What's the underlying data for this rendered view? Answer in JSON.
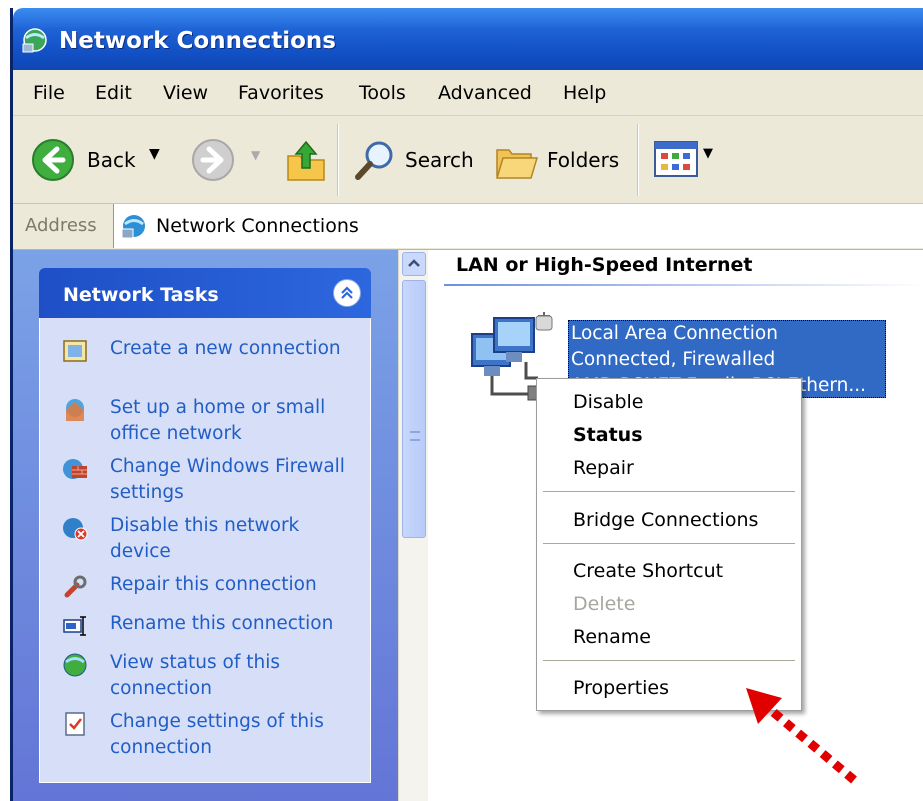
{
  "window": {
    "title": "Network Connections"
  },
  "menu": [
    "File",
    "Edit",
    "View",
    "Favorites",
    "Tools",
    "Advanced",
    "Help"
  ],
  "toolbar": {
    "back": "Back",
    "search": "Search",
    "folders": "Folders"
  },
  "address": {
    "label": "Address",
    "value": "Network Connections"
  },
  "tasks": {
    "header": "Network Tasks",
    "items": [
      {
        "label": "Create a new connection",
        "icon": "new-connection-icon"
      },
      {
        "label": "Set up a home or small office network",
        "icon": "home-network-icon"
      },
      {
        "label": "Change Windows Firewall settings",
        "icon": "firewall-icon"
      },
      {
        "label": "Disable this network device",
        "icon": "disable-network-icon"
      },
      {
        "label": "Repair this connection",
        "icon": "repair-icon"
      },
      {
        "label": "Rename this connection",
        "icon": "rename-icon"
      },
      {
        "label": "View status of this connection",
        "icon": "status-icon"
      },
      {
        "label": "Change settings of this connection",
        "icon": "settings-icon"
      }
    ]
  },
  "content": {
    "group_header": "LAN or High-Speed Internet",
    "connection": {
      "name": "Local Area Connection",
      "status": "Connected, Firewalled",
      "device": "AMD PCNET Family PCI Ethern..."
    }
  },
  "context_menu": {
    "items": [
      "Disable",
      "Status",
      "Repair",
      "Bridge Connections",
      "Create Shortcut",
      "Delete",
      "Rename",
      "Properties"
    ],
    "default_item": "Status",
    "disabled_item": "Delete"
  },
  "colors": {
    "titlebar": "#1f63d6",
    "left_pane": "#6f8be0",
    "task_link": "#215dc6",
    "selection": "#316ac5",
    "arrow": "#e00000"
  }
}
